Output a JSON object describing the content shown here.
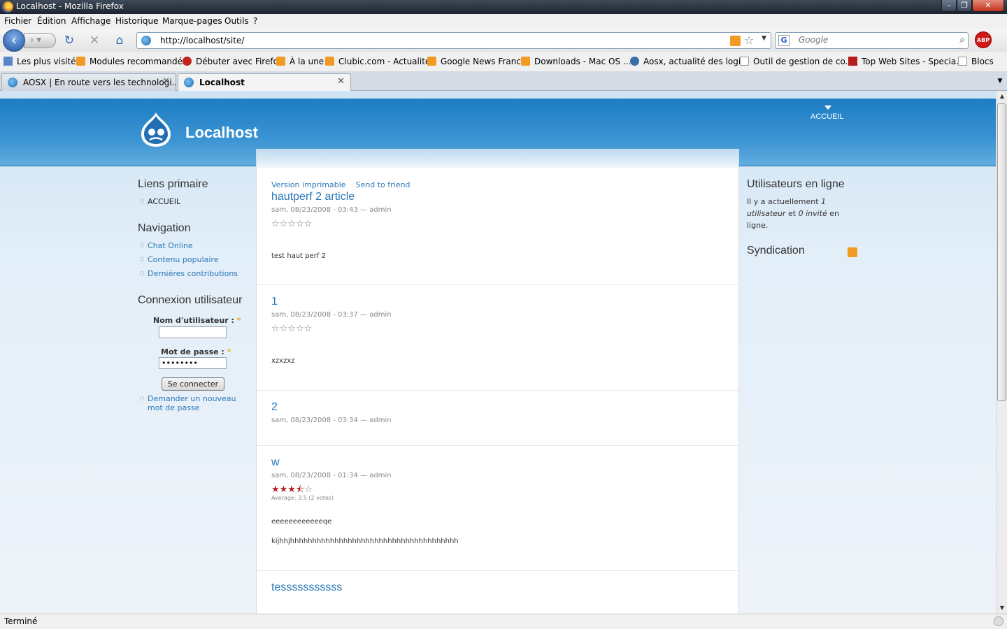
{
  "window": {
    "title": "Localhost - Mozilla Firefox",
    "min": "–",
    "max": "❐",
    "close": "✕"
  },
  "menu": [
    "Fichier",
    "Édition",
    "Affichage",
    "Historique",
    "Marque-pages",
    "Outils",
    "?"
  ],
  "toolbar": {
    "back": "‹",
    "forward": "›",
    "reload": "↻",
    "stop": "✕",
    "home": "⌂",
    "url": "http://localhost/site/",
    "search_placeholder": "Google",
    "search_engine": "G",
    "abp": "ABP"
  },
  "bookmarks": [
    {
      "label": "Les plus visités",
      "icon": "blue"
    },
    {
      "label": "Modules recommandés",
      "icon": "rss"
    },
    {
      "label": "Débuter avec Firefox",
      "icon": "red"
    },
    {
      "label": "À la une",
      "icon": "rss"
    },
    {
      "label": "Clubic.com - Actualité",
      "icon": "rss"
    },
    {
      "label": "Google News France",
      "icon": "rss"
    },
    {
      "label": "Downloads - Mac OS ...",
      "icon": "rss"
    },
    {
      "label": "Aosx, actualité des logi...",
      "icon": "wp"
    },
    {
      "label": "Outil de gestion de co...",
      "icon": "doc"
    },
    {
      "label": "Top Web Sites - Specia...",
      "icon": "pc"
    },
    {
      "label": "Blocs",
      "icon": "doc"
    }
  ],
  "tabs": [
    {
      "label": "AOSX | En route vers les technologi...",
      "close": "✕"
    },
    {
      "label": "Localhost",
      "close": "✕"
    }
  ],
  "site": {
    "name": "Localhost",
    "top_nav": "ACCUEIL",
    "primary_links_title": "Liens primaire",
    "primary_links": [
      "ACCUEIL"
    ],
    "navigation_title": "Navigation",
    "navigation": [
      "Chat Online",
      "Contenu populaire",
      "Dernières contributions"
    ],
    "login_title": "Connexion utilisateur",
    "username_label": "Nom d'utilisateur :",
    "password_label": "Mot de passe :",
    "required_mark": "*",
    "username_value": "",
    "password_value": "••••••••",
    "login_button": "Se connecter",
    "new_password_link_1": "Demander un nouveau",
    "new_password_link_2": "mot de passe",
    "online_title": "Utilisateurs en ligne",
    "online_text_1": "Il y a actuellement ",
    "online_text_2": "1 utilisateur",
    "online_text_3": " et ",
    "online_text_4": "0 invité",
    "online_text_5": " en ligne.",
    "syndication_title": "Syndication"
  },
  "nodes": [
    {
      "links": [
        "Version imprimable",
        "Send to friend"
      ],
      "title": "hautperf 2 article",
      "meta": "sam, 08/23/2008 - 03:43 — admin",
      "rating": 0,
      "body": [
        "test haut perf 2"
      ]
    },
    {
      "title": "1",
      "meta": "sam, 08/23/2008 - 03:37 — admin",
      "rating": 0,
      "body": [
        "xzxzxz"
      ]
    },
    {
      "title": "2",
      "meta": "sam, 08/23/2008 - 03:34 — admin"
    },
    {
      "title": "w",
      "meta": "sam, 08/23/2008 - 01:34 — admin",
      "rating": 3.5,
      "average": "Average: 3.5 (2 votes)",
      "body": [
        "eeeeeeeeeeeeqe",
        "kijhhjhhhhhhhhhhhhhhhhhhhhhhhhhhhhhhhhhhhhhh"
      ]
    },
    {
      "title": "tesssssssssss"
    }
  ],
  "status": "Terminé"
}
